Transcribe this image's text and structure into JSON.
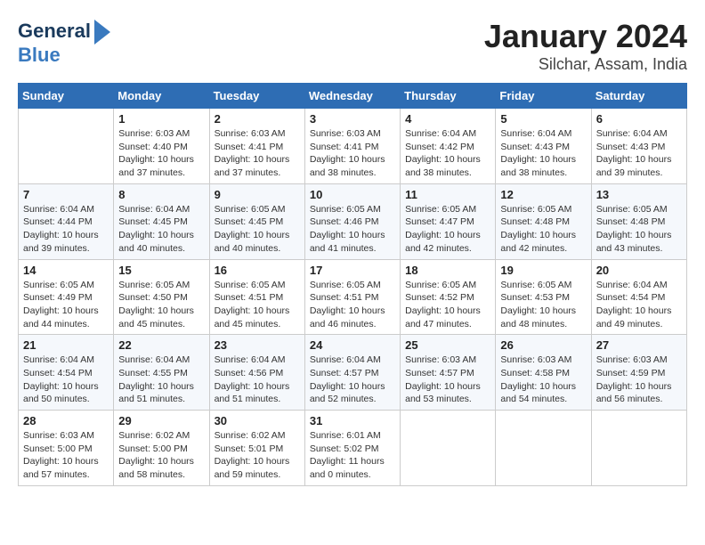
{
  "logo": {
    "line1": "General",
    "line2": "Blue"
  },
  "title": "January 2024",
  "subtitle": "Silchar, Assam, India",
  "header_days": [
    "Sunday",
    "Monday",
    "Tuesday",
    "Wednesday",
    "Thursday",
    "Friday",
    "Saturday"
  ],
  "weeks": [
    [
      {
        "day": "",
        "sunrise": "",
        "sunset": "",
        "daylight": ""
      },
      {
        "day": "1",
        "sunrise": "Sunrise: 6:03 AM",
        "sunset": "Sunset: 4:40 PM",
        "daylight": "Daylight: 10 hours and 37 minutes."
      },
      {
        "day": "2",
        "sunrise": "Sunrise: 6:03 AM",
        "sunset": "Sunset: 4:41 PM",
        "daylight": "Daylight: 10 hours and 37 minutes."
      },
      {
        "day": "3",
        "sunrise": "Sunrise: 6:03 AM",
        "sunset": "Sunset: 4:41 PM",
        "daylight": "Daylight: 10 hours and 38 minutes."
      },
      {
        "day": "4",
        "sunrise": "Sunrise: 6:04 AM",
        "sunset": "Sunset: 4:42 PM",
        "daylight": "Daylight: 10 hours and 38 minutes."
      },
      {
        "day": "5",
        "sunrise": "Sunrise: 6:04 AM",
        "sunset": "Sunset: 4:43 PM",
        "daylight": "Daylight: 10 hours and 38 minutes."
      },
      {
        "day": "6",
        "sunrise": "Sunrise: 6:04 AM",
        "sunset": "Sunset: 4:43 PM",
        "daylight": "Daylight: 10 hours and 39 minutes."
      }
    ],
    [
      {
        "day": "7",
        "sunrise": "Sunrise: 6:04 AM",
        "sunset": "Sunset: 4:44 PM",
        "daylight": "Daylight: 10 hours and 39 minutes."
      },
      {
        "day": "8",
        "sunrise": "Sunrise: 6:04 AM",
        "sunset": "Sunset: 4:45 PM",
        "daylight": "Daylight: 10 hours and 40 minutes."
      },
      {
        "day": "9",
        "sunrise": "Sunrise: 6:05 AM",
        "sunset": "Sunset: 4:45 PM",
        "daylight": "Daylight: 10 hours and 40 minutes."
      },
      {
        "day": "10",
        "sunrise": "Sunrise: 6:05 AM",
        "sunset": "Sunset: 4:46 PM",
        "daylight": "Daylight: 10 hours and 41 minutes."
      },
      {
        "day": "11",
        "sunrise": "Sunrise: 6:05 AM",
        "sunset": "Sunset: 4:47 PM",
        "daylight": "Daylight: 10 hours and 42 minutes."
      },
      {
        "day": "12",
        "sunrise": "Sunrise: 6:05 AM",
        "sunset": "Sunset: 4:48 PM",
        "daylight": "Daylight: 10 hours and 42 minutes."
      },
      {
        "day": "13",
        "sunrise": "Sunrise: 6:05 AM",
        "sunset": "Sunset: 4:48 PM",
        "daylight": "Daylight: 10 hours and 43 minutes."
      }
    ],
    [
      {
        "day": "14",
        "sunrise": "Sunrise: 6:05 AM",
        "sunset": "Sunset: 4:49 PM",
        "daylight": "Daylight: 10 hours and 44 minutes."
      },
      {
        "day": "15",
        "sunrise": "Sunrise: 6:05 AM",
        "sunset": "Sunset: 4:50 PM",
        "daylight": "Daylight: 10 hours and 45 minutes."
      },
      {
        "day": "16",
        "sunrise": "Sunrise: 6:05 AM",
        "sunset": "Sunset: 4:51 PM",
        "daylight": "Daylight: 10 hours and 45 minutes."
      },
      {
        "day": "17",
        "sunrise": "Sunrise: 6:05 AM",
        "sunset": "Sunset: 4:51 PM",
        "daylight": "Daylight: 10 hours and 46 minutes."
      },
      {
        "day": "18",
        "sunrise": "Sunrise: 6:05 AM",
        "sunset": "Sunset: 4:52 PM",
        "daylight": "Daylight: 10 hours and 47 minutes."
      },
      {
        "day": "19",
        "sunrise": "Sunrise: 6:05 AM",
        "sunset": "Sunset: 4:53 PM",
        "daylight": "Daylight: 10 hours and 48 minutes."
      },
      {
        "day": "20",
        "sunrise": "Sunrise: 6:04 AM",
        "sunset": "Sunset: 4:54 PM",
        "daylight": "Daylight: 10 hours and 49 minutes."
      }
    ],
    [
      {
        "day": "21",
        "sunrise": "Sunrise: 6:04 AM",
        "sunset": "Sunset: 4:54 PM",
        "daylight": "Daylight: 10 hours and 50 minutes."
      },
      {
        "day": "22",
        "sunrise": "Sunrise: 6:04 AM",
        "sunset": "Sunset: 4:55 PM",
        "daylight": "Daylight: 10 hours and 51 minutes."
      },
      {
        "day": "23",
        "sunrise": "Sunrise: 6:04 AM",
        "sunset": "Sunset: 4:56 PM",
        "daylight": "Daylight: 10 hours and 51 minutes."
      },
      {
        "day": "24",
        "sunrise": "Sunrise: 6:04 AM",
        "sunset": "Sunset: 4:57 PM",
        "daylight": "Daylight: 10 hours and 52 minutes."
      },
      {
        "day": "25",
        "sunrise": "Sunrise: 6:03 AM",
        "sunset": "Sunset: 4:57 PM",
        "daylight": "Daylight: 10 hours and 53 minutes."
      },
      {
        "day": "26",
        "sunrise": "Sunrise: 6:03 AM",
        "sunset": "Sunset: 4:58 PM",
        "daylight": "Daylight: 10 hours and 54 minutes."
      },
      {
        "day": "27",
        "sunrise": "Sunrise: 6:03 AM",
        "sunset": "Sunset: 4:59 PM",
        "daylight": "Daylight: 10 hours and 56 minutes."
      }
    ],
    [
      {
        "day": "28",
        "sunrise": "Sunrise: 6:03 AM",
        "sunset": "Sunset: 5:00 PM",
        "daylight": "Daylight: 10 hours and 57 minutes."
      },
      {
        "day": "29",
        "sunrise": "Sunrise: 6:02 AM",
        "sunset": "Sunset: 5:00 PM",
        "daylight": "Daylight: 10 hours and 58 minutes."
      },
      {
        "day": "30",
        "sunrise": "Sunrise: 6:02 AM",
        "sunset": "Sunset: 5:01 PM",
        "daylight": "Daylight: 10 hours and 59 minutes."
      },
      {
        "day": "31",
        "sunrise": "Sunrise: 6:01 AM",
        "sunset": "Sunset: 5:02 PM",
        "daylight": "Daylight: 11 hours and 0 minutes."
      },
      {
        "day": "",
        "sunrise": "",
        "sunset": "",
        "daylight": ""
      },
      {
        "day": "",
        "sunrise": "",
        "sunset": "",
        "daylight": ""
      },
      {
        "day": "",
        "sunrise": "",
        "sunset": "",
        "daylight": ""
      }
    ]
  ]
}
